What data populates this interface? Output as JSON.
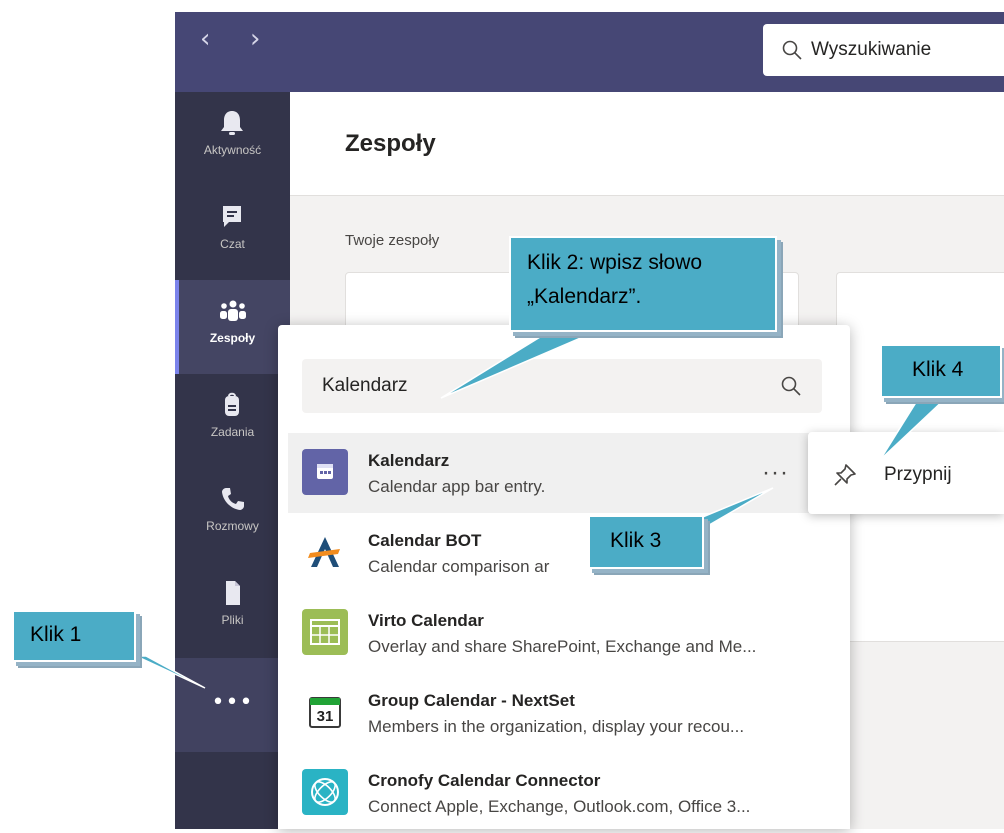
{
  "window": {
    "nav_back": "‹",
    "nav_forward": "›",
    "search_placeholder": "Wyszukiwanie"
  },
  "rail": {
    "items": [
      {
        "label": "Aktywność",
        "icon": "bell-icon"
      },
      {
        "label": "Czat",
        "icon": "chat-icon"
      },
      {
        "label": "Zespoły",
        "icon": "teams-icon",
        "active": true
      },
      {
        "label": "Zadania",
        "icon": "backpack-icon"
      },
      {
        "label": "Rozmowy",
        "icon": "phone-icon"
      },
      {
        "label": "Pliki",
        "icon": "file-icon"
      }
    ],
    "more": "•••"
  },
  "main": {
    "title": "Zespoły",
    "section_label": "Twoje zespoły"
  },
  "flyout": {
    "search_value": "Kalendarz",
    "apps": [
      {
        "name": "Kalendarz",
        "desc": "Calendar app bar entry.",
        "icon": "calendar-icon",
        "highlighted": true
      },
      {
        "name": "Calendar BOT",
        "desc": "Calendar comparison ar",
        "icon": "calendar-bot-logo"
      },
      {
        "name": "Virto Calendar",
        "desc": "Overlay and share SharePoint, Exchange and Me...",
        "icon": "virto-calendar-icon"
      },
      {
        "name": "Group Calendar - NextSet",
        "desc": "Members in the organization, display your recou...",
        "icon": "group-calendar-icon",
        "badge": "31"
      },
      {
        "name": "Cronofy Calendar Connector",
        "desc": "Connect Apple, Exchange, Outlook.com, Office 3...",
        "icon": "cronofy-icon"
      }
    ],
    "row_more": "···"
  },
  "pin_menu": {
    "label": "Przypnij",
    "icon": "pin-icon"
  },
  "callouts": {
    "klik1": "Klik 1",
    "klik2_line1": "Klik 2: wpisz słowo",
    "klik2_line2": "„Kalendarz”.",
    "klik3": "Klik 3",
    "klik4": "Klik 4"
  },
  "colors": {
    "accent": "#464775",
    "rail": "#33344a",
    "callout": "#4bacc6"
  }
}
